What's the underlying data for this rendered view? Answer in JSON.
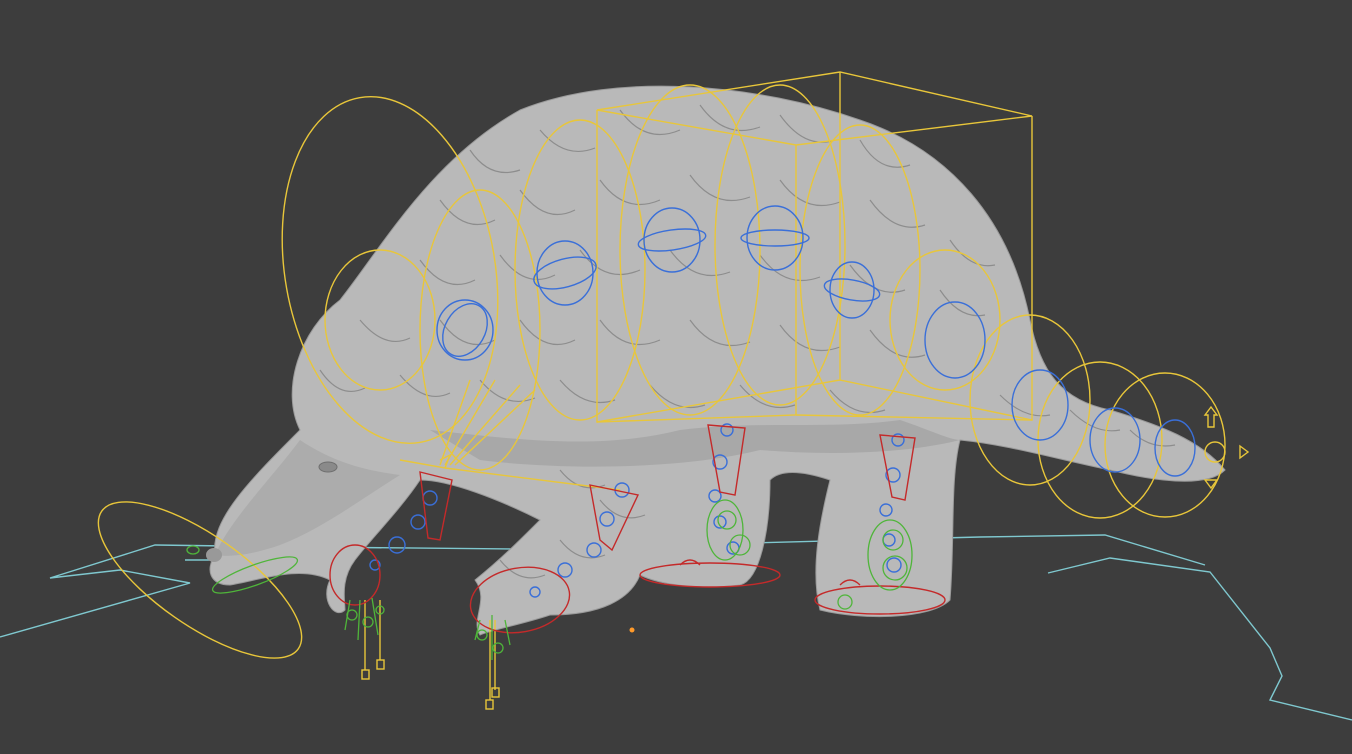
{
  "viewport": {
    "background": "#3d3d3d",
    "model_color": "#b9b9b9",
    "model_shade": "#8f8f8f",
    "scale_outline_color": "#6a6a6a",
    "rig_colors": {
      "main_controls": "#e8c63a",
      "fk_controls": "#3a6fd8",
      "ik_controls": "#c42a2a",
      "tweak_controls": "#4fb53a",
      "ground_outline": "#7fc8cf",
      "origin_point": "#ff9a2a"
    },
    "icons": [
      "3d-origin-icon",
      "root-arrow-icon"
    ],
    "label": ""
  }
}
